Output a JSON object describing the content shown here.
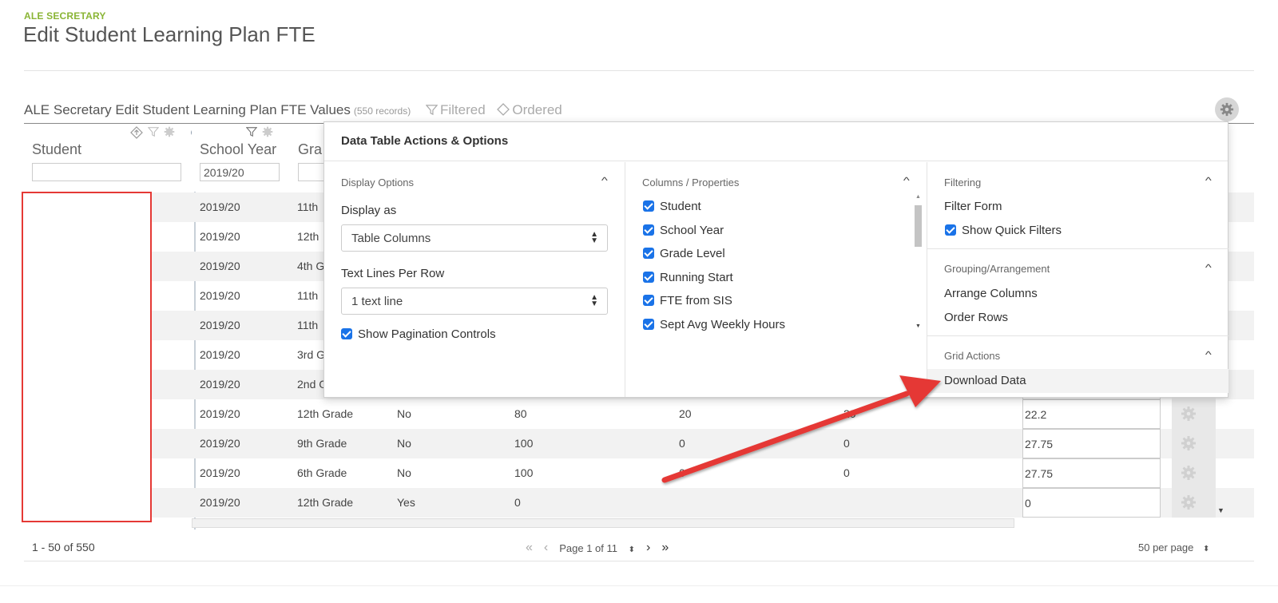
{
  "header": {
    "breadcrumb": "ALE SECRETARY",
    "title": "Edit Student Learning Plan FTE"
  },
  "table": {
    "title": "ALE Secretary Edit Student Learning Plan FTE Values",
    "record_count": "(550 records)",
    "filtered_label": "Filtered",
    "ordered_label": "Ordered",
    "columns": {
      "student": "Student",
      "school_year": "School Year",
      "grade": "Gra"
    },
    "filters": {
      "student": "",
      "school_year": "2019/20",
      "grade": ""
    },
    "rows": [
      {
        "year": "2019/20",
        "grade": "11th",
        "rs": "",
        "c1": "",
        "c2": "",
        "c3": "",
        "fte": ""
      },
      {
        "year": "2019/20",
        "grade": "12th",
        "rs": "",
        "c1": "",
        "c2": "",
        "c3": "",
        "fte": ""
      },
      {
        "year": "2019/20",
        "grade": "4th G",
        "rs": "",
        "c1": "",
        "c2": "",
        "c3": "",
        "fte": ""
      },
      {
        "year": "2019/20",
        "grade": "11th",
        "rs": "",
        "c1": "",
        "c2": "",
        "c3": "",
        "fte": ""
      },
      {
        "year": "2019/20",
        "grade": "11th",
        "rs": "",
        "c1": "",
        "c2": "",
        "c3": "",
        "fte": ""
      },
      {
        "year": "2019/20",
        "grade": "3rd G",
        "rs": "",
        "c1": "",
        "c2": "",
        "c3": "",
        "fte": ""
      },
      {
        "year": "2019/20",
        "grade": "2nd G",
        "rs": "",
        "c1": "",
        "c2": "",
        "c3": "",
        "fte": ""
      },
      {
        "year": "2019/20",
        "grade": "12th Grade",
        "rs": "No",
        "c1": "80",
        "c2": "20",
        "c3": "20",
        "fte": "22.2"
      },
      {
        "year": "2019/20",
        "grade": "9th Grade",
        "rs": "No",
        "c1": "100",
        "c2": "0",
        "c3": "0",
        "fte": "27.75"
      },
      {
        "year": "2019/20",
        "grade": "6th Grade",
        "rs": "No",
        "c1": "100",
        "c2": "0",
        "c3": "0",
        "fte": "27.75"
      },
      {
        "year": "2019/20",
        "grade": "12th Grade",
        "rs": "Yes",
        "c1": "0",
        "c2": "",
        "c3": "",
        "fte": "0"
      }
    ]
  },
  "pagination": {
    "range": "1 - 50 of 550",
    "page_label": "Page 1 of 11",
    "per_page": "50 per page"
  },
  "panel": {
    "title": "Data Table Actions & Options",
    "display": {
      "section": "Display Options",
      "display_as_label": "Display as",
      "display_as_value": "Table Columns",
      "lines_label": "Text Lines Per Row",
      "lines_value": "1 text line",
      "pagination_label": "Show Pagination Controls"
    },
    "columns": {
      "section": "Columns / Properties",
      "items": [
        "Student",
        "School Year",
        "Grade Level",
        "Running Start",
        "FTE from SIS",
        "Sept Avg Weekly Hours"
      ]
    },
    "filtering": {
      "section": "Filtering",
      "filter_form": "Filter Form",
      "quick_filters": "Show Quick Filters"
    },
    "grouping": {
      "section": "Grouping/Arrangement",
      "arrange": "Arrange Columns",
      "order": "Order Rows"
    },
    "grid_actions": {
      "section": "Grid Actions",
      "download": "Download Data"
    }
  },
  "colors": {
    "breadcrumb": "#8ab535",
    "checkbox": "#1a73e8",
    "annotation": "#e53935"
  }
}
